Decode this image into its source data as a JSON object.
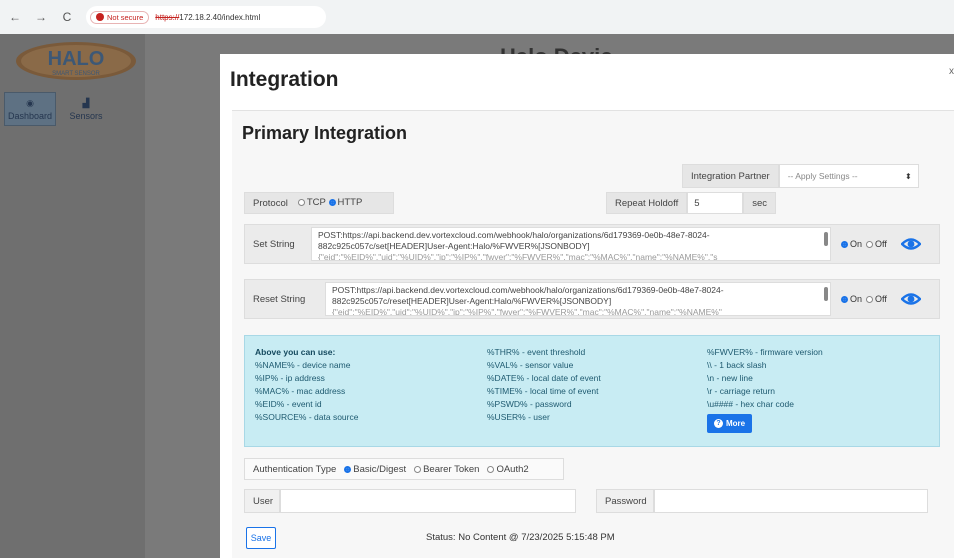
{
  "browser": {
    "not_secure": "Not secure",
    "url_scheme": "https://",
    "url_rest": "172.18.2.40/index.html"
  },
  "sidebar": {
    "logo_text": "HALO",
    "logo_sub": "SMART SENSOR",
    "tabs": [
      {
        "label": "Dashboard",
        "icon": "dashboard-icon",
        "active": true
      },
      {
        "label": "Sensors",
        "icon": "sensors-icon",
        "active": false
      }
    ]
  },
  "background_title": "Halo Devic",
  "modal": {
    "title": "Integration",
    "close": "x",
    "section_title": "Primary Integration",
    "integration_partner": {
      "label": "Integration Partner",
      "selected": "-- Apply Settings --"
    },
    "protocol": {
      "label": "Protocol",
      "options": [
        "TCP",
        "HTTP"
      ],
      "selected": "HTTP"
    },
    "repeat_holdoff": {
      "label": "Repeat Holdoff",
      "value": "5",
      "unit": "sec"
    },
    "set_string": {
      "label": "Set String",
      "line1": "POST:https://api.backend.dev.vortexcloud.com/webhook/halo/organizations/6d179369-0e0b-48e7-8024-",
      "line2": "882c925c057c/set[HEADER]User-Agent:Halo/%FWVER%[JSONBODY]",
      "line3": "{\"eid\":\"%EID%\",\"uid\":\"%UID%\",\"ip\":\"%IP%\",\"fwver\":\"%FWVER%\",\"mac\":\"%MAC%\",\"name\":\"%NAME%\",\"s",
      "on": "On",
      "off": "Off",
      "state": "On"
    },
    "reset_string": {
      "label": "Reset String",
      "line1": "POST:https://api.backend.dev.vortexcloud.com/webhook/halo/organizations/6d179369-0e0b-48e7-8024-",
      "line2": "882c925c057c/reset[HEADER]User-Agent:Halo/%FWVER%[JSONBODY]",
      "line3": "{\"eid\":\"%EID%\",\"uid\":\"%UID%\",\"ip\":\"%IP%\",\"fwver\":\"%FWVER%\",\"mac\":\"%MAC%\",\"name\":\"%NAME%\"",
      "on": "On",
      "off": "Off",
      "state": "On"
    },
    "help": {
      "col1": [
        "Above you can use:",
        "%NAME% - device name",
        "%IP% - ip address",
        "%MAC% - mac address",
        "%EID% - event id",
        "%SOURCE% - data source"
      ],
      "col2": [
        "%THR% - event threshold",
        "%VAL% - sensor value",
        "%DATE% - local date of event",
        "%TIME% - local time of event",
        "%PSWD% - password",
        "%USER% - user"
      ],
      "col3": [
        "%FWVER% - firmware version",
        "\\\\ - 1 back slash",
        "\\n - new line",
        "\\r - carriage return",
        "\\u#### - hex char code"
      ],
      "more_label": "More"
    },
    "auth": {
      "label": "Authentication Type",
      "options": [
        "Basic/Digest",
        "Bearer Token",
        "OAuth2"
      ],
      "selected": "Basic/Digest"
    },
    "user_label": "User",
    "user_value": "",
    "password_label": "Password",
    "password_value": "",
    "save_label": "Save",
    "status": "Status: No Content @ 7/23/2025 5:15:48 PM"
  },
  "colors": {
    "accent": "#1a73e8",
    "help_bg": "#c8ecf3",
    "overlay": "#7a7a7a"
  }
}
